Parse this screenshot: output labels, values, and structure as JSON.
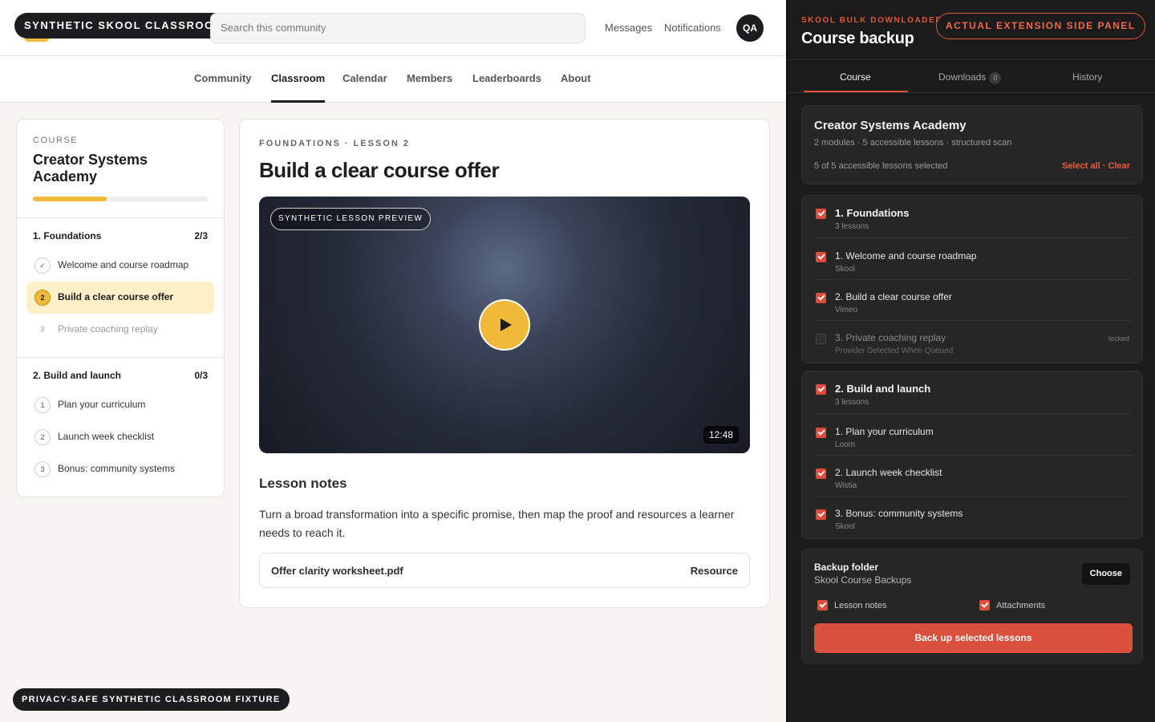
{
  "header": {
    "brand_label": "SYNTHETIC SKOOL CLASSROOM",
    "search_placeholder": "Search this community",
    "messages": "Messages",
    "notifications": "Notifications",
    "avatar_initials": "QA"
  },
  "nav": {
    "tabs": [
      {
        "label": "Community"
      },
      {
        "label": "Classroom"
      },
      {
        "label": "Calendar"
      },
      {
        "label": "Members"
      },
      {
        "label": "Leaderboards"
      },
      {
        "label": "About"
      }
    ],
    "active_tab": "Classroom"
  },
  "course": {
    "kicker": "COURSE",
    "title": "Creator Systems Academy",
    "progress_fraction": 0.42,
    "modules": [
      {
        "title": "1. Foundations",
        "count": "2/3",
        "lessons": [
          {
            "marker": "✓",
            "title": "Welcome and course roadmap",
            "state": "done"
          },
          {
            "marker": "2",
            "title": "Build a clear course offer",
            "state": "active"
          },
          {
            "marker": "3",
            "title": "Private coaching replay",
            "state": "locked"
          }
        ]
      },
      {
        "title": "2. Build and launch",
        "count": "0/3",
        "lessons": [
          {
            "marker": "1",
            "title": "Plan your curriculum",
            "state": "open"
          },
          {
            "marker": "2",
            "title": "Launch week checklist",
            "state": "open"
          },
          {
            "marker": "3",
            "title": "Bonus: community systems",
            "state": "open"
          }
        ]
      }
    ]
  },
  "lesson": {
    "kicker": "FOUNDATIONS · LESSON 2",
    "title": "Build a clear course offer",
    "video_badge": "SYNTHETIC LESSON PREVIEW",
    "duration": "12:48",
    "notes_heading": "Lesson notes",
    "notes_text": "Turn a broad transformation into a specific promise, then map the proof and resources a learner needs to reach it.",
    "resource_name": "Offer clarity worksheet.pdf",
    "resource_type": "Resource"
  },
  "footer_label": "PRIVACY-SAFE SYNTHETIC CLASSROOM FIXTURE",
  "panel": {
    "kicker": "SKOOL BULK DOWNLOADER",
    "title": "Course backup",
    "badge": "ACTUAL EXTENSION SIDE PANEL",
    "tabs": {
      "course": "Course",
      "downloads": "Downloads",
      "downloads_count": "0",
      "history": "History"
    },
    "summary": {
      "title": "Creator Systems Academy",
      "meta": "2 modules · 5 accessible lessons · structured scan",
      "selected": "5 of 5 accessible lessons selected",
      "select_all": "Select all",
      "dot": "·",
      "clear": "Clear"
    },
    "modules": [
      {
        "title": "1. Foundations",
        "sub": "3 lessons",
        "lessons": [
          {
            "title": "1. Welcome and course roadmap",
            "provider": "Skool",
            "checked": true
          },
          {
            "title": "2. Build a clear course offer",
            "provider": "Vimeo",
            "checked": true
          },
          {
            "title": "3. Private coaching replay",
            "provider": "Provider Detected When Queued",
            "checked": false,
            "locked_label": "locked"
          }
        ]
      },
      {
        "title": "2. Build and launch",
        "sub": "3 lessons",
        "lessons": [
          {
            "title": "1. Plan your curriculum",
            "provider": "Loom",
            "checked": true
          },
          {
            "title": "2. Launch week checklist",
            "provider": "Wistia",
            "checked": true
          },
          {
            "title": "3. Bonus: community systems",
            "provider": "Skool",
            "checked": true
          }
        ]
      }
    ],
    "backup": {
      "title": "Backup folder",
      "path": "Skool Course Backups",
      "choose": "Choose",
      "opt_notes": "Lesson notes",
      "opt_attachments": "Attachments",
      "button": "Back up selected lessons"
    },
    "colors": {
      "accent": "#e0543b",
      "course_yellow": "#f0b93a"
    }
  }
}
